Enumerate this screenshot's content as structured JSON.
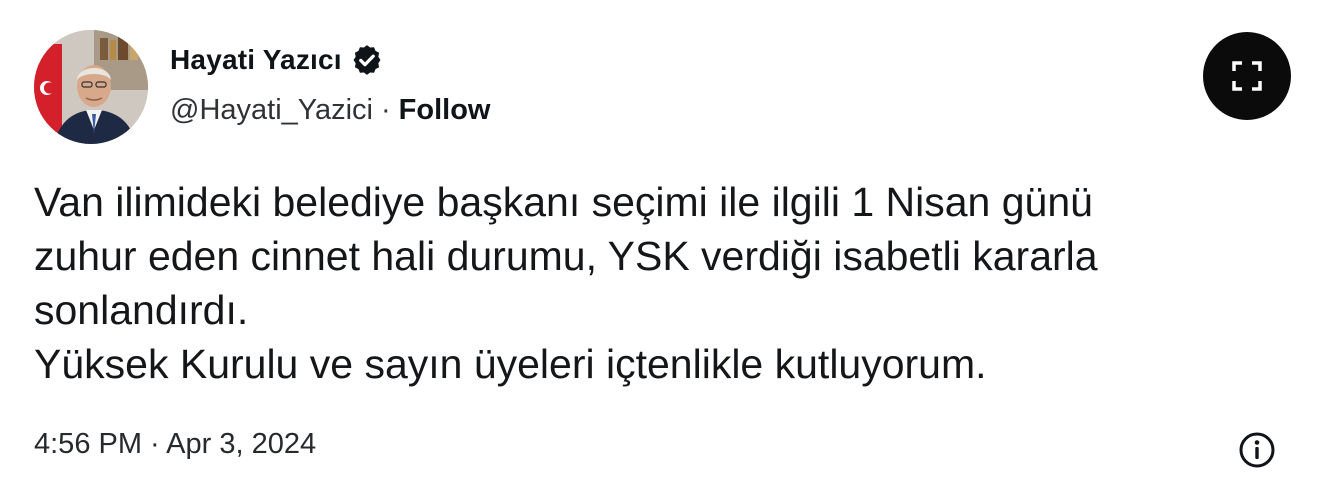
{
  "author": {
    "display_name": "Hayati Yazıcı",
    "handle": "@Hayati_Yazici",
    "separator": "·",
    "follow_label": "Follow",
    "verified_icon": "verified-badge-icon"
  },
  "tweet": {
    "lines": [
      "Van ilimideki belediye başkanı seçimi ile ilgili 1 Nisan günü",
      "zuhur eden cinnet hali durumu, YSK verdiği isabetli kararla",
      "sonlandırdı.",
      "Yüksek Kurulu ve sayın üyeleri içtenlikle kutluyorum."
    ],
    "timestamp": "4:56 PM · Apr 3, 2024"
  },
  "controls": {
    "expand_icon": "expand-icon",
    "info_icon": "info-icon"
  },
  "colors": {
    "text": "#0f1419",
    "expand_bg": "#0b0b0b"
  }
}
